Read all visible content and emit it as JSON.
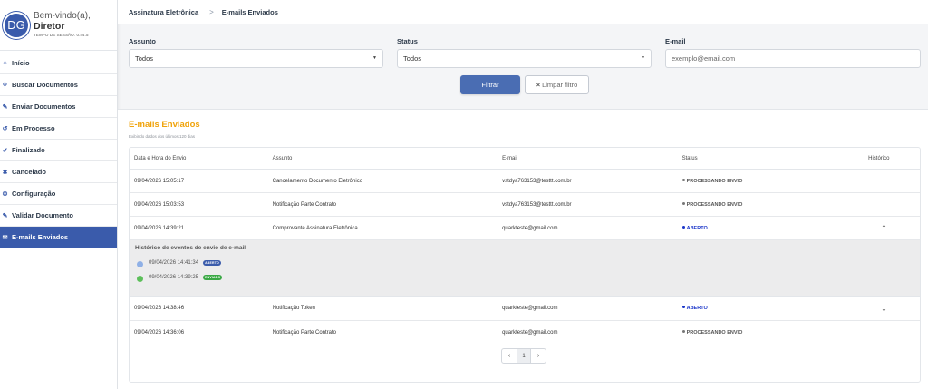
{
  "user": {
    "initials": "DG",
    "welcome": "Bem-vindo(a),",
    "name": "Diretor",
    "session": "TEMPO DE SESSÃO: 0:44:5"
  },
  "sidebar": {
    "items": [
      {
        "label": "Início",
        "icon": "home-icon"
      },
      {
        "label": "Buscar Documentos",
        "icon": "search-icon"
      },
      {
        "label": "Enviar Documentos",
        "icon": "send-document-icon"
      },
      {
        "label": "Em Processo",
        "icon": "in-process-icon"
      },
      {
        "label": "Finalizado",
        "icon": "check-circle-icon"
      },
      {
        "label": "Cancelado",
        "icon": "cancel-circle-icon"
      },
      {
        "label": "Configuração",
        "icon": "gear-icon"
      },
      {
        "label": "Validar Documento",
        "icon": "validate-document-icon"
      },
      {
        "label": "E-mails Enviados",
        "icon": "envelope-icon"
      }
    ],
    "active_index": 8
  },
  "breadcrumb": {
    "first": "Assinatura Eletrônica",
    "separator": ">",
    "second": "E-mails Enviados"
  },
  "filters": {
    "subject_label": "Assunto",
    "subject_value": "Todos",
    "status_label": "Status",
    "status_value": "Todos",
    "email_label": "E-mail",
    "email_placeholder": "exemplo@email.com",
    "filter_button": "Filtrar",
    "clear_button": "Limpar filtro",
    "clear_icon": "×"
  },
  "section": {
    "title": "E-mails Enviados",
    "subtitle": "Exibindo dados dos últimos 120 dias"
  },
  "table": {
    "columns": [
      "Data e Hora do Envio",
      "Assunto",
      "E-mail",
      "Status",
      "Histórico"
    ],
    "rows": [
      {
        "datetime": "09/04/2026 15:05:17",
        "subject": "Cancelamento Documento Eletrônico",
        "email": "vstdya763153@testtt.com.br",
        "status": "PROCESSANDO ENVIO"
      },
      {
        "datetime": "09/04/2026 15:03:53",
        "subject": "Notificação Parte Contrato",
        "email": "vstdya763153@testtt.com.br",
        "status": "PROCESSANDO ENVIO"
      },
      {
        "datetime": "09/04/2026 14:39:21",
        "subject": "Comprovante Assinatura Eletrônica",
        "email": "quarkteste@gmail.com",
        "status": "ABERTO",
        "expanded": true
      },
      {
        "datetime": "09/04/2026 14:38:46",
        "subject": "Notificação Token",
        "email": "quarkteste@gmail.com",
        "status": "ABERTO"
      },
      {
        "datetime": "09/04/2026 14:36:06",
        "subject": "Notificação Parte Contrato",
        "email": "quarkteste@gmail.com",
        "status": "PROCESSANDO ENVIO"
      }
    ]
  },
  "history": {
    "title": "Histórico de eventos de envio de e-mail",
    "events": [
      {
        "datetime": "09/04/2026 14:41:34",
        "badge": "ABERTO",
        "color": "#3a5bab",
        "dot": "#8fb0e6"
      },
      {
        "datetime": "09/04/2026 14:39:25",
        "badge": "ENVIADO",
        "color": "#3aa845",
        "dot": "#5cbf5a"
      }
    ]
  },
  "pagination": {
    "prev": "‹",
    "current": "1",
    "next": "›"
  },
  "colors": {
    "primary": "#3a5bab",
    "accent_title": "#f0a30a",
    "status_open": "#1b36c9"
  }
}
